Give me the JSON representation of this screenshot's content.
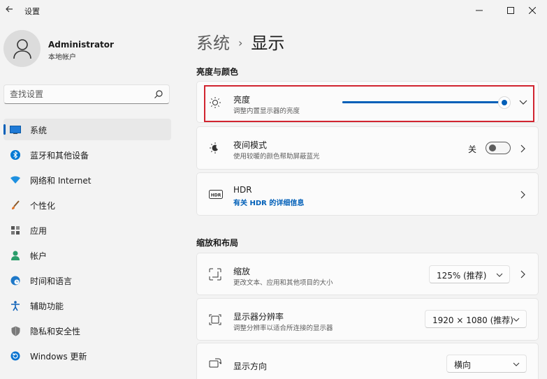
{
  "window": {
    "title": "设置"
  },
  "user": {
    "name": "Administrator",
    "account_type": "本地帐户"
  },
  "search": {
    "placeholder": "查找设置"
  },
  "sidebar": {
    "items": [
      {
        "label": "系统",
        "icon": "system-icon",
        "active": true,
        "color": "#0067c0"
      },
      {
        "label": "蓝牙和其他设备",
        "icon": "bluetooth-icon",
        "color": "#0078d4"
      },
      {
        "label": "网络和 Internet",
        "icon": "network-icon",
        "color": "#1e90e0"
      },
      {
        "label": "个性化",
        "icon": "brush-icon",
        "color": "#d46a1e"
      },
      {
        "label": "应用",
        "icon": "apps-icon",
        "color": "#5a5a5a"
      },
      {
        "label": "帐户",
        "icon": "account-icon",
        "color": "#2a9d6a"
      },
      {
        "label": "时间和语言",
        "icon": "globe-clock-icon",
        "color": "#1e78c8"
      },
      {
        "label": "辅助功能",
        "icon": "accessibility-icon",
        "color": "#1063b8"
      },
      {
        "label": "隐私和安全性",
        "icon": "shield-icon",
        "color": "#6b6b6b"
      },
      {
        "label": "Windows 更新",
        "icon": "update-icon",
        "color": "#0a74d0"
      }
    ]
  },
  "breadcrumb": {
    "parent": "系统",
    "separator": "›",
    "current": "显示"
  },
  "sections": {
    "brightness_color": "亮度与颜色",
    "scale_layout": "缩放和布局"
  },
  "cards": {
    "brightness": {
      "title": "亮度",
      "subtitle": "调整内置显示器的亮度",
      "value_percent": 100
    },
    "night_light": {
      "title": "夜间模式",
      "subtitle": "使用较暖的颜色帮助屏蔽蓝光",
      "toggle_label": "关",
      "on": false
    },
    "hdr": {
      "title": "HDR",
      "link": "有关 HDR 的详细信息",
      "icon_text": "HDR"
    },
    "scale": {
      "title": "缩放",
      "subtitle": "更改文本、应用和其他项目的大小",
      "value": "125% (推荐)"
    },
    "resolution": {
      "title": "显示器分辨率",
      "subtitle": "调整分辨率以适合所连接的显示器",
      "value": "1920 × 1080 (推荐)"
    },
    "orientation": {
      "title": "显示方向",
      "value": "横向"
    }
  },
  "colors": {
    "accent": "#005fb8",
    "highlight_box": "#d1242f"
  }
}
